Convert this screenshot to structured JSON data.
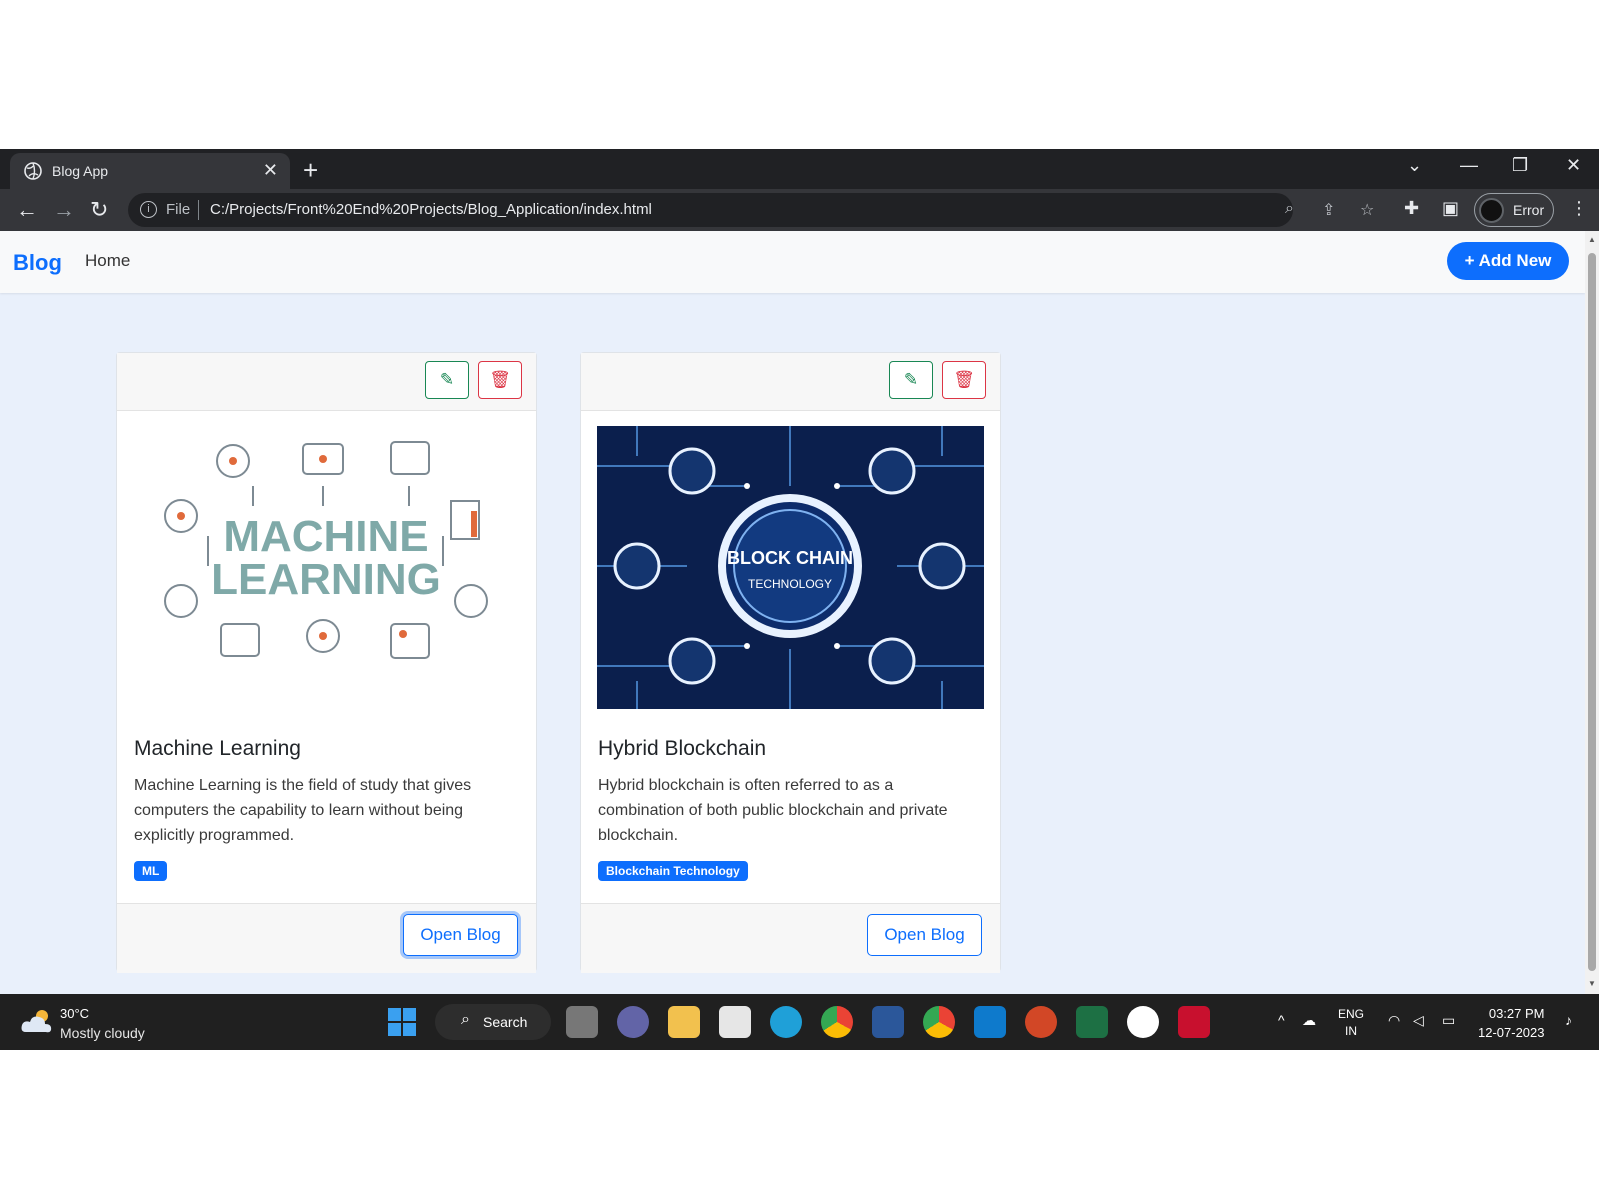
{
  "browser": {
    "tab_title": "Blog App",
    "tab_close": "✕",
    "new_tab": "+",
    "address_scheme": "File",
    "address_url": "C:/Projects/Front%20End%20Projects/Blog_Application/index.html",
    "profile_label": "Error"
  },
  "navbar": {
    "brand": "Blog",
    "home": "Home",
    "add_new": "+ Add New"
  },
  "posts": [
    {
      "title": "Machine Learning",
      "description": "Machine Learning is the field of study that gives computers the capability to learn without being explicitly programmed.",
      "tag": "ML",
      "button": "Open Blog",
      "image_text_1": "MACHINE",
      "image_text_2": "LEARNING"
    },
    {
      "title": "Hybrid Blockchain",
      "description": "Hybrid blockchain is often referred to as a combination of both public blockchain and private blockchain.",
      "tag": "Blockchain Technology",
      "button": "Open Blog",
      "image_text_1": "BLOCK CHAIN",
      "image_text_2": "TECHNOLOGY"
    }
  ],
  "taskbar": {
    "temperature": "30°C",
    "weather": "Mostly cloudy",
    "search": "Search",
    "lang_1": "ENG",
    "lang_2": "IN",
    "time": "03:27 PM",
    "date": "12-07-2023"
  },
  "colors": {
    "primary": "#0d6efd",
    "edit": "#198754",
    "delete": "#dc3545",
    "page_bg": "#e9f0fb"
  }
}
